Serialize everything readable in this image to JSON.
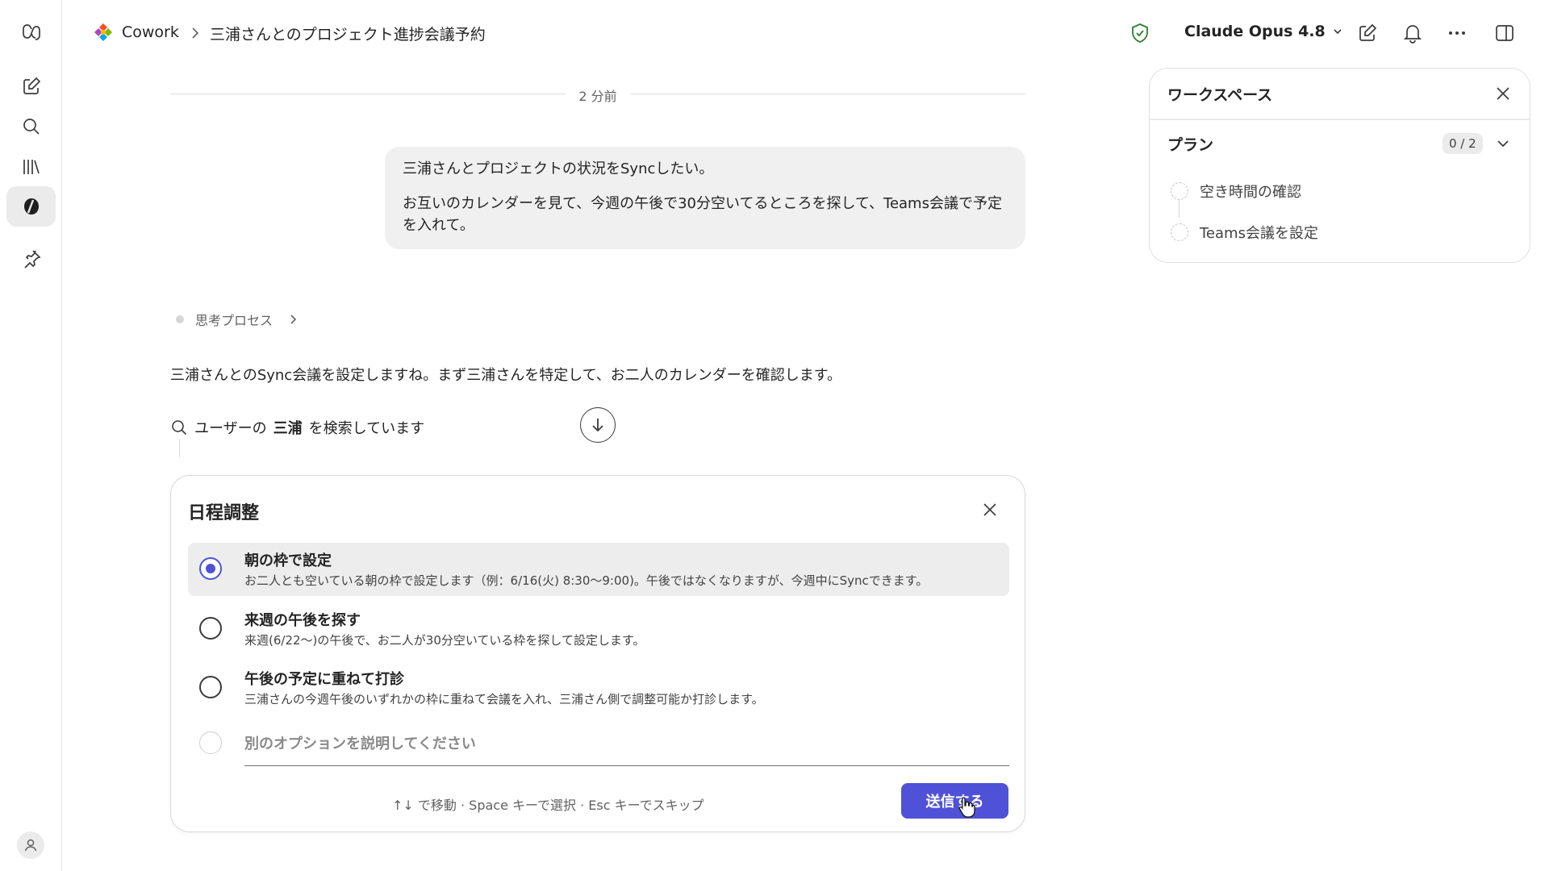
{
  "app": {
    "name": "Cowork",
    "conversation_title": "三浦さんとのプロジェクト進捗会議予約"
  },
  "header": {
    "model_label": "Claude Opus 4.8"
  },
  "chat": {
    "timestamp": "2 分前",
    "user_message": {
      "line1": "三浦さんとプロジェクトの状況をSyncしたい。",
      "line2": "お互いのカレンダーを見て、今週の午後で30分空いてるところを探して、Teams会議で予定を入れて。"
    },
    "thinking_label": "思考プロセス",
    "assistant_message": "三浦さんとのSync会議を設定しますね。まず三浦さんを特定して、お二人のカレンダーを確認します。",
    "tool_call": {
      "prefix": "ユーザーの",
      "query": "三浦",
      "suffix": "を検索しています"
    }
  },
  "question_card": {
    "title": "日程調整",
    "options": [
      {
        "title": "朝の枠で設定",
        "description": "お二人とも空いている朝の枠で設定します（例：6/16(火) 8:30〜9:00)。午後ではなくなりますが、今週中にSyncできます。",
        "selected": true
      },
      {
        "title": "来週の午後を探す",
        "description": "来週(6/22〜)の午後で、お二人が30分空いている枠を探して設定します。",
        "selected": false
      },
      {
        "title": "午後の予定に重ねて打診",
        "description": "三浦さんの今週午後のいずれかの枠に重ねて会議を入れ、三浦さん側で調整可能か打診します。",
        "selected": false
      }
    ],
    "other_placeholder": "別のオプションを説明してください",
    "hint": "↑↓ で移動 · Space キーで選択 · Esc キーでスキップ",
    "submit_label": "送信する"
  },
  "workspace": {
    "title": "ワークスペース",
    "plan_label": "プラン",
    "plan_count": "0 / 2",
    "plan_items": [
      "空き時間の確認",
      "Teams会議を設定"
    ]
  },
  "colors": {
    "accent": "#4f52d6",
    "shield": "#2e7d32"
  }
}
